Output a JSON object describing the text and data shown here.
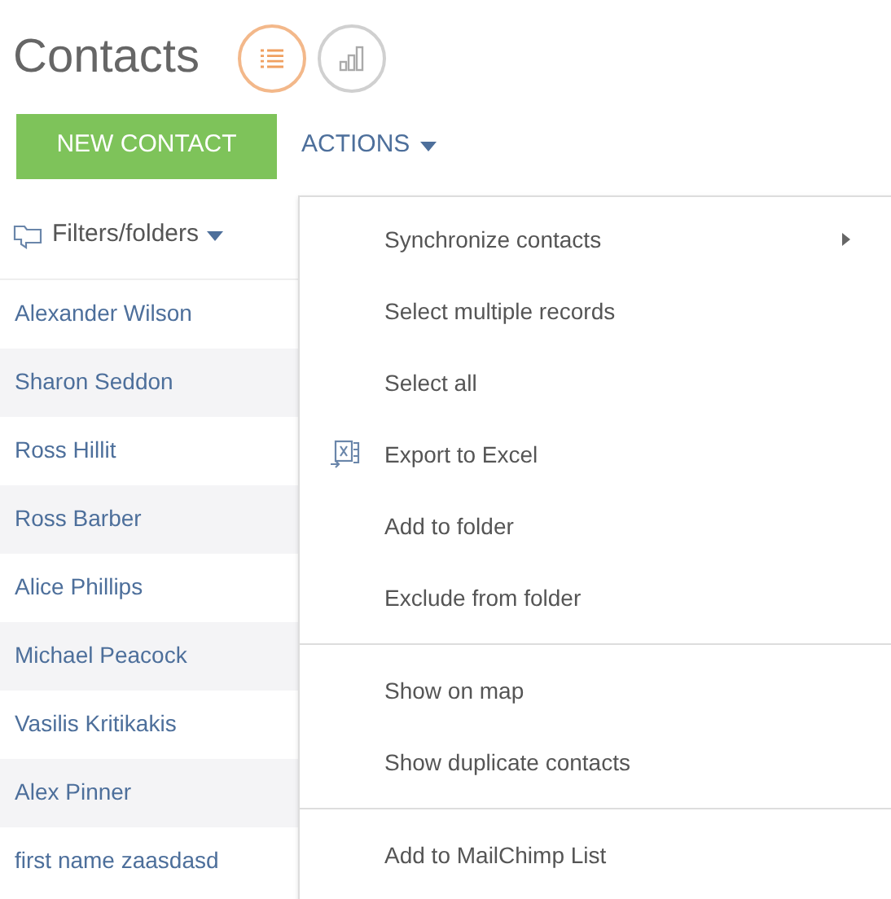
{
  "page_title": "Contacts",
  "view_buttons": [
    {
      "kind": "list",
      "selected": true
    },
    {
      "kind": "chart",
      "selected": false
    }
  ],
  "new_button": "NEW CONTACT",
  "actions_button": "ACTIONS",
  "filters": "Filters/folders",
  "contacts": [
    "Alexander Wilson",
    "Sharon Seddon",
    "Ross Hillit",
    "Ross Barber",
    "Alice Phillips",
    "Michael Peacock",
    "Vasilis Kritikakis",
    "Alex Pinner",
    "first name zaasdasd"
  ],
  "menu_groups": [
    [
      {
        "label": "Synchronize contacts",
        "kind": "submenu"
      },
      {
        "label": "Select multiple records",
        "kind": "plain"
      },
      {
        "label": "Select all",
        "kind": "plain"
      },
      {
        "label": "Export to Excel",
        "kind": "excel"
      },
      {
        "label": "Add to folder",
        "kind": "plain"
      },
      {
        "label": "Exclude from folder",
        "kind": "plain"
      }
    ],
    [
      {
        "label": "Show on map",
        "kind": "plain"
      },
      {
        "label": "Show duplicate contacts",
        "kind": "plain"
      }
    ],
    [
      {
        "label": "Add to MailChimp List",
        "kind": "plain"
      }
    ]
  ]
}
